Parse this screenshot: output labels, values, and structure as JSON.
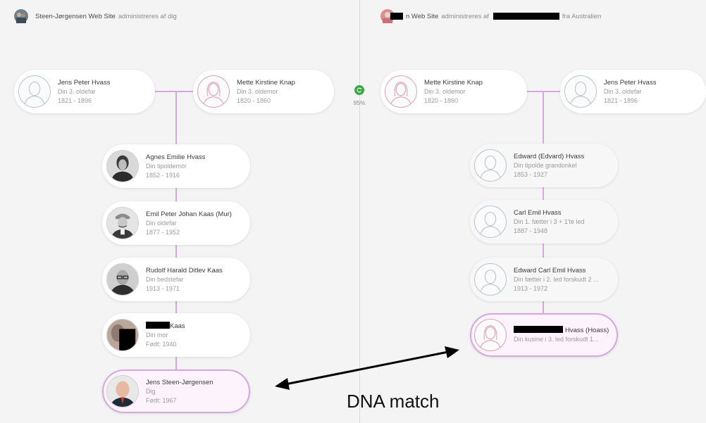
{
  "left_site": {
    "title": "Steen-Jørgensen Web Site",
    "managed": "administreres af dig"
  },
  "right_site": {
    "title_suffix": "n Web Site",
    "managed": "administreres af",
    "location": "fra Australien"
  },
  "match": {
    "percent": "95%",
    "icon": "refresh-icon",
    "color": "#39a845"
  },
  "connector_color": "#d9a6e4",
  "highlight_color": "#d7a7e0",
  "left": {
    "ancestor_male": {
      "name": "Jens Peter Hvass",
      "relation": "Din 3. oldefar",
      "years": "1821 - 1896",
      "icon": "male-silhouette-icon"
    },
    "ancestor_female": {
      "name": "Mette Kirstine Knap",
      "relation": "Din 3. oldemor",
      "years": "1820 - 1860",
      "icon": "female-silhouette-icon"
    },
    "people": [
      {
        "name": "Agnes Emilie Hvass",
        "relation": "Din tipoldemor",
        "years": "1852 - 1916",
        "icon": "portrait-photo-icon"
      },
      {
        "name": "Emil Peter Johan Kaas (Mur)",
        "relation": "Din oldefar",
        "years": "1877 - 1952",
        "icon": "portrait-photo-icon"
      },
      {
        "name": "Rudolf Harald Ditlev Kaas",
        "relation": "Din bedstefar",
        "years": "1913 - 1971",
        "icon": "portrait-photo-icon"
      },
      {
        "name_suffix": "Kaas",
        "relation": "Din mor",
        "years": "Født: 1940",
        "icon": "portrait-photo-icon"
      },
      {
        "name": "Jens Steen-Jørgensen",
        "relation": "Dig",
        "years": "Født: 1967",
        "icon": "portrait-photo-icon"
      }
    ]
  },
  "right": {
    "ancestor_female": {
      "name": "Mette Kirstine Knap",
      "relation": "Din 3. oldemor",
      "years": "1820 - 1860",
      "icon": "female-silhouette-icon"
    },
    "ancestor_male": {
      "name": "Jens Peter Hvass",
      "relation": "Din 3. oldefar",
      "years": "1821 - 1896",
      "icon": "male-silhouette-icon"
    },
    "people": [
      {
        "name": "Edward (Edvard) Hvass",
        "relation": "Din tipolde grandonkel",
        "years": "1853 - 1927",
        "icon": "male-silhouette-icon"
      },
      {
        "name": "Carl Emil Hvass",
        "relation": "Din 1. fætter i 3 + 1'te led",
        "years": "1887 - 1948",
        "icon": "male-silhouette-icon"
      },
      {
        "name": "Edward Carl Emil Hvass",
        "relation": "Din fætter i 2. led forskudt 2 ...",
        "years": "1913 - 1972",
        "icon": "male-silhouette-icon"
      },
      {
        "name_suffix": "Hvass (Hoass)",
        "relation": "Din kusine i 3. led forskudt 1...",
        "icon": "female-silhouette-icon"
      }
    ]
  },
  "annotation": {
    "label": "DNA match",
    "icon": "double-arrow-icon"
  }
}
